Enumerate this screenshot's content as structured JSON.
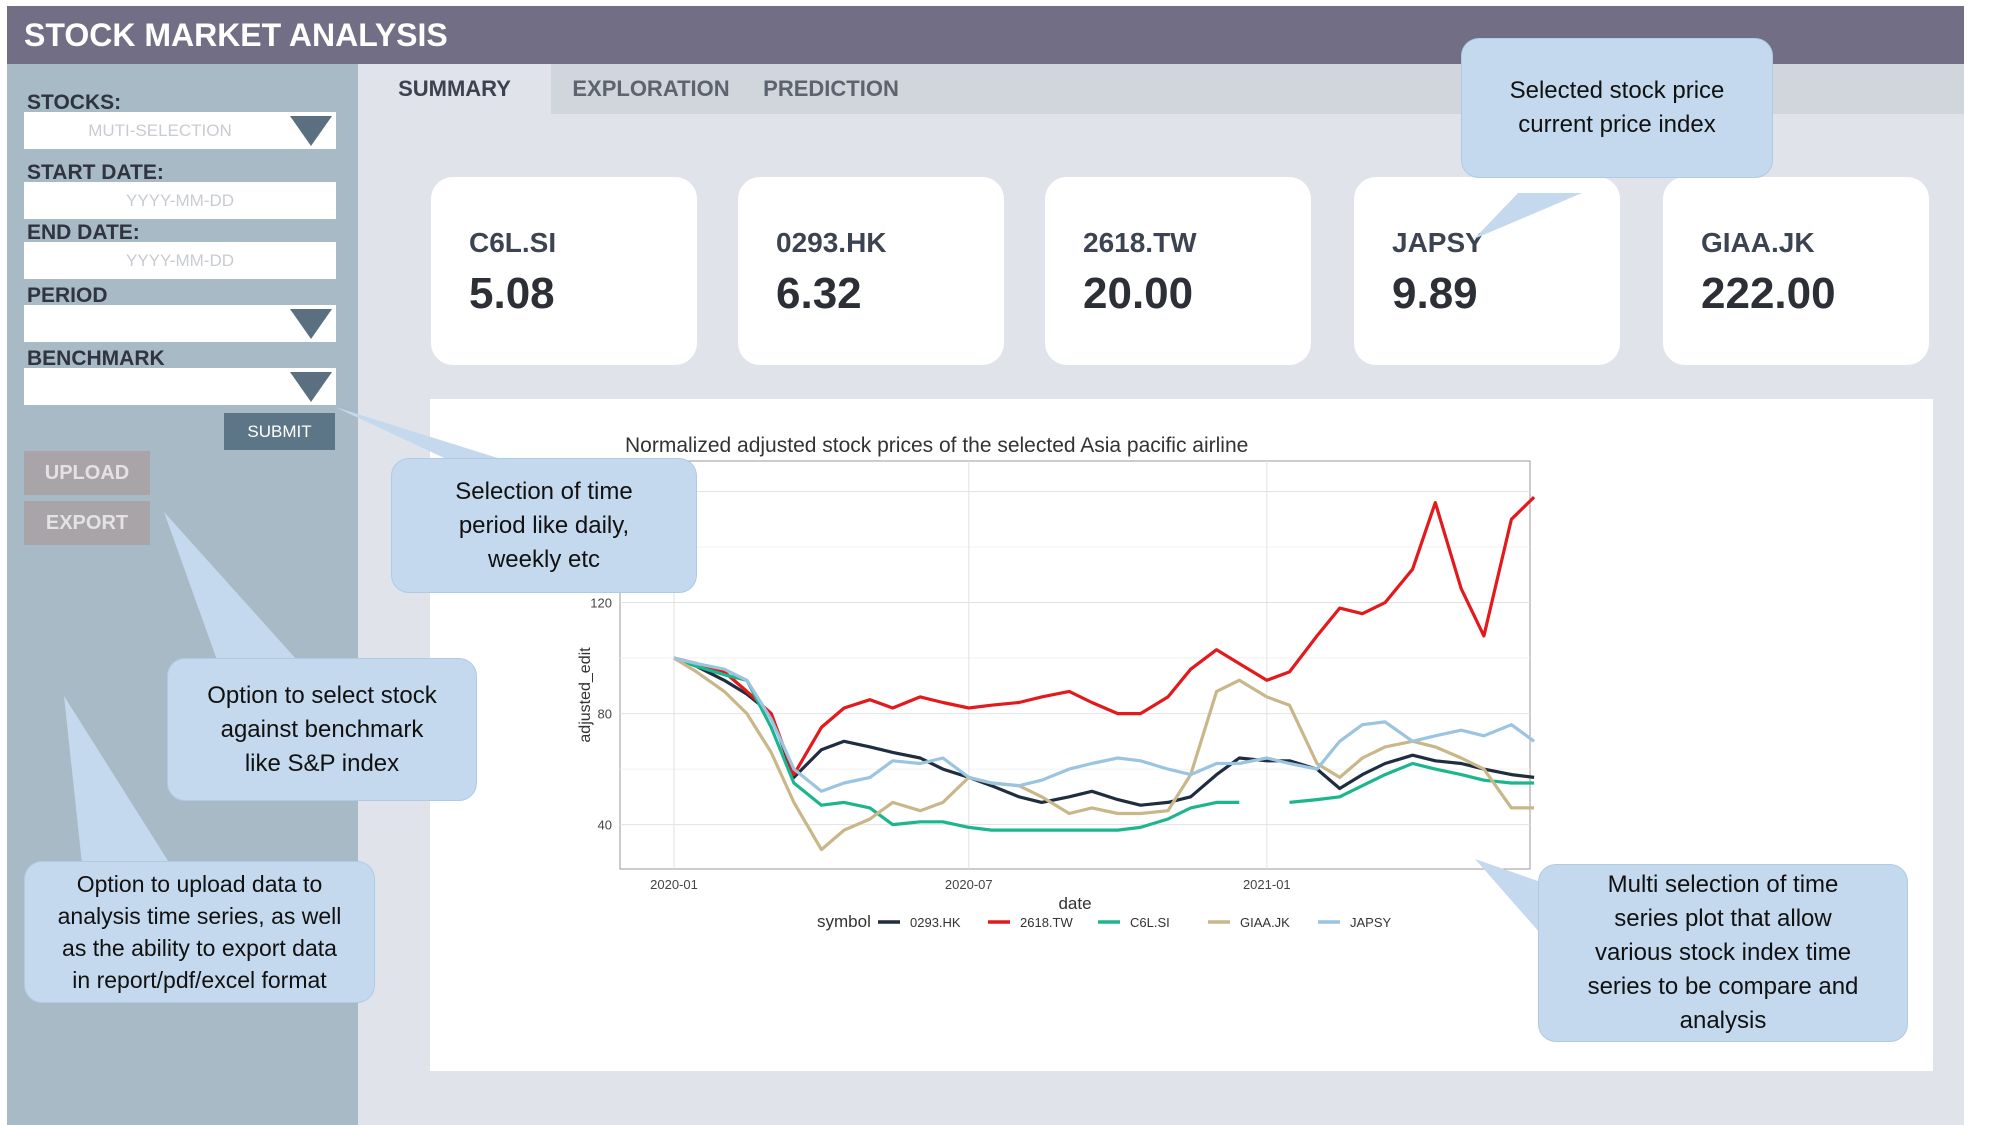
{
  "app": {
    "title": "STOCK MARKET ANALYSIS"
  },
  "sidebar": {
    "stocks_label": "STOCKS:",
    "stocks_placeholder": "MUTI-SELECTION",
    "start_label": "START DATE:",
    "start_placeholder": "YYYY-MM-DD",
    "end_label": "END DATE:",
    "end_placeholder": "YYYY-MM-DD",
    "period_label": "PERIOD",
    "benchmark_label": "BENCHMARK",
    "submit_label": "SUBMIT",
    "upload_label": "UPLOAD",
    "export_label": "EXPORT"
  },
  "tabs": [
    {
      "label": "SUMMARY",
      "active": true
    },
    {
      "label": "EXPLORATION",
      "active": false
    },
    {
      "label": "PREDICTION",
      "active": false
    }
  ],
  "cards": [
    {
      "symbol": "C6L.SI",
      "price": "5.08"
    },
    {
      "symbol": "0293.HK",
      "price": "6.32"
    },
    {
      "symbol": "2618.TW",
      "price": "20.00"
    },
    {
      "symbol": "JAPSY",
      "price": "9.89"
    },
    {
      "symbol": "GIAA.JK",
      "price": "222.00"
    }
  ],
  "callouts": {
    "price_index": [
      "Selected stock price",
      "current price index"
    ],
    "period": [
      "Selection of time",
      "period like daily,",
      "weekly etc"
    ],
    "benchmark": [
      "Option to select stock",
      "against benchmark",
      "like S&P index"
    ],
    "upload": [
      "Option to upload data to",
      "analysis time series, as well",
      "as the ability to export data",
      "in report/pdf/excel  format"
    ],
    "multi": [
      "Multi selection of time",
      "series plot that allow",
      "various stock index time",
      "series to be compare and",
      "analysis"
    ]
  },
  "chart_data": {
    "type": "line",
    "title": "Normalized adjusted stock prices of the selected Asia pacific airline",
    "xlabel": "date",
    "ylabel": "adjusted_edit",
    "x_ticks": [
      "2020-01",
      "2020-07",
      "2021-01"
    ],
    "y_ticks": [
      40,
      80,
      120
    ],
    "ylim": [
      24,
      171
    ],
    "grid": true,
    "legend_title": "symbol",
    "legend_position": "bottom",
    "x": [
      "2020-01-01",
      "2020-01-15",
      "2020-02-01",
      "2020-02-15",
      "2020-03-01",
      "2020-03-15",
      "2020-04-01",
      "2020-04-15",
      "2020-05-01",
      "2020-05-15",
      "2020-06-01",
      "2020-06-15",
      "2020-07-01",
      "2020-07-15",
      "2020-08-01",
      "2020-08-15",
      "2020-09-01",
      "2020-09-15",
      "2020-10-01",
      "2020-10-15",
      "2020-11-01",
      "2020-11-15",
      "2020-12-01",
      "2020-12-15",
      "2021-01-01",
      "2021-01-15",
      "2021-02-01",
      "2021-02-15",
      "2021-03-01",
      "2021-03-15",
      "2021-04-01",
      "2021-04-15",
      "2021-05-01",
      "2021-05-15",
      "2021-06-01",
      "2021-06-15"
    ],
    "series": [
      {
        "name": "0293.HK",
        "color": "#1f2d40",
        "values": [
          100,
          97,
          92,
          87,
          80,
          57,
          67,
          70,
          68,
          66,
          64,
          60,
          57,
          54,
          50,
          48,
          50,
          52,
          49,
          47,
          48,
          50,
          58,
          64,
          63,
          63,
          60,
          53,
          58,
          62,
          65,
          63,
          62,
          60,
          58,
          57
        ]
      },
      {
        "name": "2618.TW",
        "color": "#e3191c",
        "values": [
          100,
          98,
          95,
          88,
          80,
          58,
          75,
          82,
          85,
          82,
          86,
          84,
          82,
          83,
          84,
          86,
          88,
          84,
          80,
          80,
          86,
          96,
          103,
          98,
          92,
          95,
          108,
          118,
          116,
          120,
          132,
          156,
          125,
          108,
          150,
          158
        ]
      },
      {
        "name": "C6L.SI",
        "color": "#1db58d",
        "values": [
          100,
          97,
          94,
          92,
          75,
          55,
          47,
          48,
          46,
          40,
          41,
          41,
          39,
          38,
          38,
          38,
          38,
          38,
          38,
          39,
          42,
          46,
          48,
          48,
          null,
          48,
          49,
          50,
          54,
          58,
          62,
          60,
          58,
          56,
          55,
          55
        ]
      },
      {
        "name": "GIAA.JK",
        "color": "#c9b78a",
        "values": [
          100,
          95,
          88,
          80,
          66,
          48,
          31,
          38,
          42,
          48,
          45,
          48,
          57,
          55,
          54,
          50,
          44,
          46,
          44,
          44,
          45,
          58,
          88,
          92,
          86,
          83,
          62,
          57,
          64,
          68,
          70,
          68,
          64,
          60,
          46,
          46
        ]
      },
      {
        "name": "JAPSY",
        "color": "#9ac4df",
        "values": [
          100,
          98,
          96,
          92,
          78,
          60,
          52,
          55,
          57,
          63,
          62,
          64,
          57,
          55,
          54,
          56,
          60,
          62,
          64,
          63,
          60,
          58,
          62,
          62,
          64,
          62,
          60,
          70,
          76,
          77,
          70,
          72,
          74,
          72,
          76,
          70
        ]
      }
    ]
  }
}
